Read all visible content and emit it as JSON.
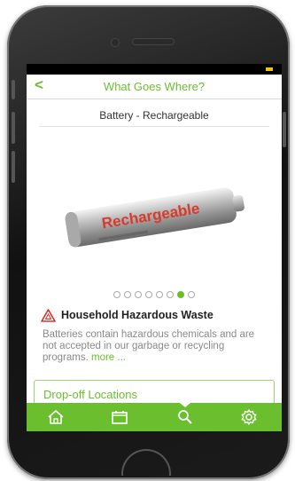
{
  "header": {
    "title": "What Goes Where?",
    "back_icon": "chevron-left-icon"
  },
  "item": {
    "name": "Battery - Rechargeable",
    "image_label": "Rechargeable",
    "category": "Household Hazardous Waste",
    "description": "Batteries contain hazardous chemicals and are not accepted in our garbage or recycling programs.",
    "more_link": "more ..."
  },
  "pager": {
    "count": 8,
    "active_index": 6
  },
  "dropoff": {
    "label": "Drop-off Locations"
  },
  "tabs": [
    {
      "icon": "home-icon"
    },
    {
      "icon": "calendar-icon"
    },
    {
      "icon": "search-icon",
      "active": true
    },
    {
      "icon": "gear-icon"
    }
  ],
  "colors": {
    "accent": "#6bbf2f",
    "warning": "#d9302b",
    "status_battery": "#f5c400"
  }
}
